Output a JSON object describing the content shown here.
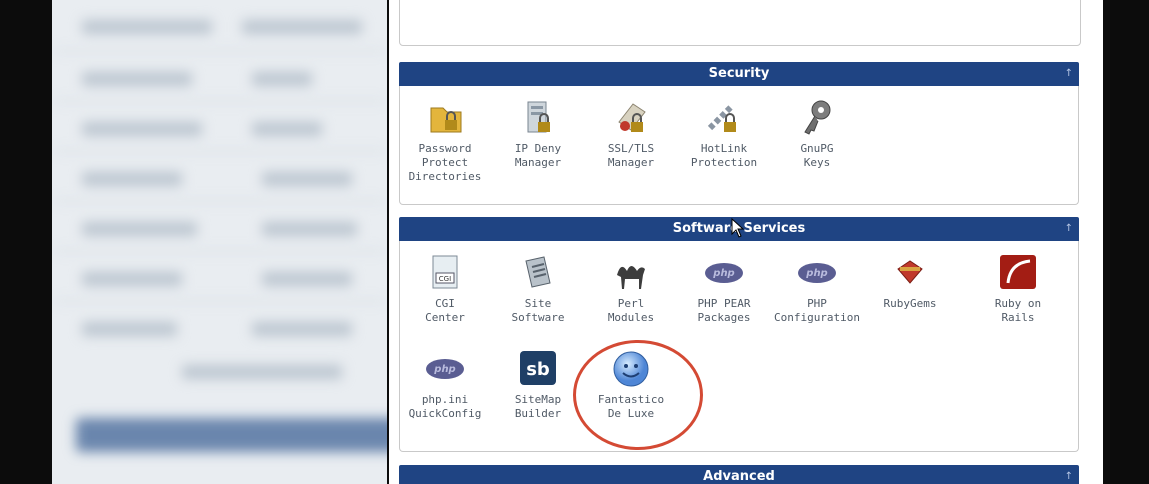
{
  "sections": {
    "security": {
      "title": "Security",
      "items": [
        {
          "label": "Password\nProtect\nDirectories",
          "icon": "folder-lock-icon"
        },
        {
          "label": "IP Deny\nManager",
          "icon": "server-lock-icon"
        },
        {
          "label": "SSL/TLS\nManager",
          "icon": "certificate-lock-icon"
        },
        {
          "label": "HotLink\nProtection",
          "icon": "chain-lock-icon"
        },
        {
          "label": "GnuPG\nKeys",
          "icon": "key-icon"
        }
      ]
    },
    "software": {
      "title": "Software Services",
      "items": [
        {
          "label": "CGI\nCenter",
          "icon": "cgi-document-icon"
        },
        {
          "label": "Site\nSoftware",
          "icon": "site-software-icon"
        },
        {
          "label": "Perl\nModules",
          "icon": "camel-icon"
        },
        {
          "label": "PHP PEAR\nPackages",
          "icon": "php-icon"
        },
        {
          "label": "PHP\nConfiguration",
          "icon": "php-icon"
        },
        {
          "label": "RubyGems",
          "icon": "ruby-gem-icon"
        },
        {
          "label": "Ruby on\nRails",
          "icon": "rails-icon"
        },
        {
          "label": "php.ini\nQuickConfig",
          "icon": "php-icon"
        },
        {
          "label": "SiteMap\nBuilder",
          "icon": "sb-icon"
        },
        {
          "label": "Fantastico\nDe Luxe",
          "icon": "smiley-face-icon"
        }
      ]
    },
    "advanced": {
      "title": "Advanced"
    }
  },
  "icons": {
    "php_text": "php",
    "sb_text": "sb",
    "cgi_text": "CGI"
  },
  "colors": {
    "header_bg": "#1f4483",
    "highlight_ring": "#d44a34"
  }
}
